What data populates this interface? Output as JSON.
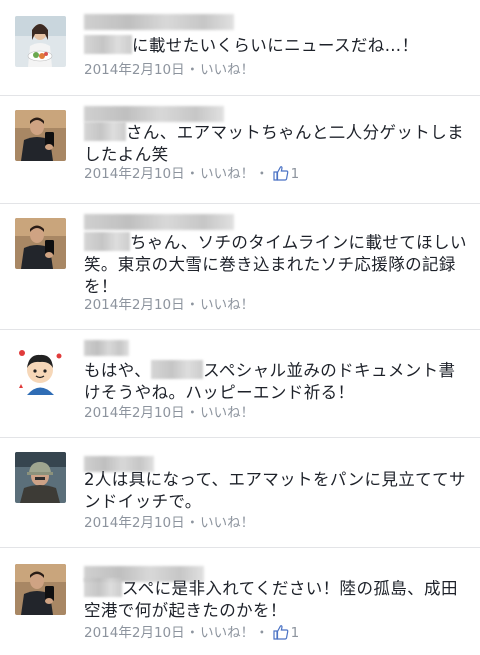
{
  "comments": [
    {
      "text_before": "",
      "text_after": "に載せたいくらいにニュースだね…！",
      "timestamp": "2014年2月10日",
      "separator": "・",
      "like_label": "いいね！",
      "like_count": null,
      "avatar_icon": "avatar-woman-with-food"
    },
    {
      "text_before": "",
      "text_after": "さん、エアマットちゃんと二人分ゲットしましたよん笑",
      "timestamp": "2014年2月10日",
      "separator": "・",
      "like_label": "いいね！",
      "like_count": "1",
      "avatar_icon": "avatar-man-selfie"
    },
    {
      "text_before": "",
      "text_after": "ちゃん、ソチのタイムラインに載せてほしい笑。東京の大雪に巻き込まれたソチ応援隊の記録を！",
      "timestamp": "2014年2月10日",
      "separator": "・",
      "like_label": "いいね！",
      "like_count": null,
      "avatar_icon": "avatar-man-selfie"
    },
    {
      "text_before": "もはや、",
      "text_after": "スペシャル並みのドキュメント書けそうやね。ハッピーエンド祈る！",
      "timestamp": "2014年2月10日",
      "separator": "・",
      "like_label": "いいね！",
      "like_count": null,
      "avatar_icon": "avatar-cartoon-boy"
    },
    {
      "text_before": "",
      "text_after": "2人は具になって、エアマットをパンに見立ててサンドイッチで。",
      "timestamp": "2014年2月10日",
      "separator": "・",
      "like_label": "いいね！",
      "like_count": null,
      "avatar_icon": "avatar-man-with-cap"
    },
    {
      "text_before": "",
      "text_after": "スペに是非入れてください！陸の孤島、成田空港で何が起きたのかを！",
      "timestamp": "2014年2月10日",
      "separator": "・",
      "like_label": "いいね！",
      "like_count": "1",
      "avatar_icon": "avatar-man-selfie"
    }
  ],
  "colors": {
    "text": "#1d2129",
    "meta": "#8d949e",
    "like_icon": "#4a72c4",
    "divider": "#e3e4e7"
  }
}
